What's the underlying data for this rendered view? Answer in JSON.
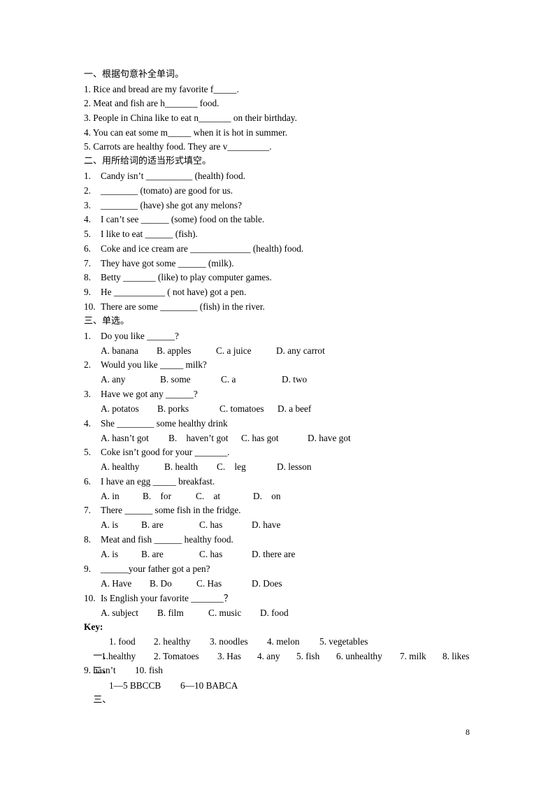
{
  "section1": {
    "title": "一、根据句意补全单词。",
    "items": [
      "1. Rice and bread are my favorite f_____.",
      "2. Meat and fish are h_______ food.",
      "3. People in China like to eat n_______ on their birthday.",
      "4. You can eat some m_____ when it is hot in summer.",
      "5. Carrots are healthy food. They are v_________."
    ]
  },
  "section2": {
    "title": "二、用所给词的适当形式填空。",
    "items": [
      {
        "num": "1.",
        "text": "Candy isn’t __________ (health) food."
      },
      {
        "num": "2.",
        "text": "________ (tomato) are good for us."
      },
      {
        "num": "3.",
        "text": "________ (have) she got any melons?"
      },
      {
        "num": "4.",
        "text": "I can’t see ______ (some) food on the table."
      },
      {
        "num": "5.",
        "text": "I like to eat ______ (fish)."
      },
      {
        "num": "6.",
        "text": "Coke and ice cream are _____________ (health) food."
      },
      {
        "num": "7.",
        "text": "They have got some ______ (milk)."
      },
      {
        "num": "8.",
        "text": "Betty _______ (like) to play computer games."
      },
      {
        "num": "9.",
        "text": "He ___________ ( not have) got a pen."
      },
      {
        "num": "10.",
        "text": "There are some ________ (fish) in the river."
      }
    ]
  },
  "section3": {
    "title": "三、单选。",
    "questions": [
      {
        "num": "1.",
        "text": "Do you like ______?",
        "options": [
          "A. banana",
          "B. apples",
          "C. a juice",
          "D. any carrot"
        ]
      },
      {
        "num": "2.",
        "text": "Would you like _____ milk?",
        "options": [
          "A. any",
          "B. some",
          "C. a",
          "D. two"
        ]
      },
      {
        "num": "3.",
        "text": "Have we got any ______?",
        "options": [
          "A. potatos",
          "B. porks",
          "C. tomatoes",
          "D. a beef"
        ]
      },
      {
        "num": "4.",
        "text": "She ________ some healthy drink",
        "options": [
          "A. hasn’t got",
          "B.    haven’t got",
          "C. has got",
          "D. have got"
        ]
      },
      {
        "num": "5.",
        "text": "Coke isn’t good for your _______.",
        "options": [
          "A. healthy",
          "B. health",
          "C.    leg",
          "D. lesson"
        ]
      },
      {
        "num": "6.",
        "text": "I have an egg _____ breakfast.",
        "options": [
          "A. in",
          "B.    for",
          "C.    at",
          "D.    on"
        ]
      },
      {
        "num": "7.",
        "text": "There ______ some fish in the fridge.",
        "options": [
          "A. is",
          "B. are",
          "C. has",
          "D. have"
        ]
      },
      {
        "num": "8.",
        "text": "Meat and fish ______ healthy food.",
        "options": [
          "A. is",
          "B. are",
          "C. has",
          "D. there are"
        ]
      },
      {
        "num": "9.",
        "text": "______your father got a pen?",
        "options": [
          "A. Have",
          "B. Do",
          "C. Has",
          "D. Does"
        ]
      },
      {
        "num": "10.",
        "text": "Is English your favorite _______？",
        "options": [
          "A. subject",
          "B. film",
          "C. music",
          "D. food"
        ]
      }
    ]
  },
  "key": {
    "label": "Key:",
    "section1": {
      "prefix": "一、",
      "answers": [
        "1. food",
        "2. healthy",
        "3. noodles",
        "4. melon",
        "5. vegetables"
      ]
    },
    "section2": {
      "prefix": "二、",
      "answers": [
        "1.healthy",
        "2. Tomatoes",
        "3. Has",
        "4. any",
        "5. fish",
        "6. unhealthy",
        "7. milk",
        "8. likes"
      ],
      "answers_line2": [
        "9. hasn’t",
        "10. fish"
      ]
    },
    "section3": {
      "prefix": "三、",
      "answers": [
        "1—5 BBCCB",
        "6—10 BABCA"
      ]
    }
  },
  "page_number": "8"
}
